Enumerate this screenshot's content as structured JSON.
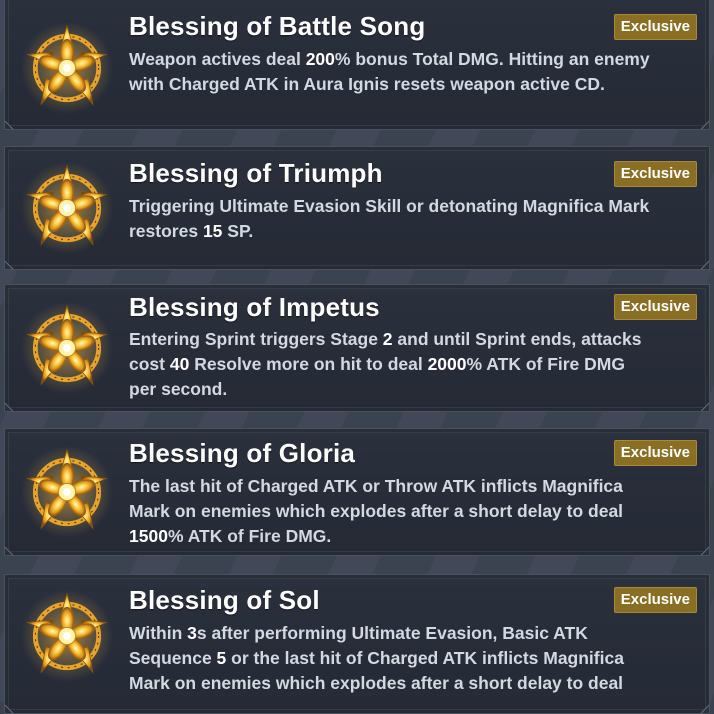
{
  "theme": {
    "badge_color": "#8a6e24",
    "card_color": "#262b36",
    "emblem_gold": "#f4c02c"
  },
  "blessings": [
    {
      "title": "Blessing of Battle Song",
      "badge": "Exclusive",
      "icon": "golden-flower-sigil-icon",
      "description": "Weapon actives deal 200% bonus Total DMG. Hitting an enemy with Charged ATK in Aura Ignis resets weapon active CD.",
      "lines": [
        "Weapon actives deal 200% bonus Total DMG. Hitting an enemy",
        "with Charged ATK in Aura Ignis resets weapon active CD."
      ]
    },
    {
      "title": "Blessing of Triumph",
      "badge": "Exclusive",
      "icon": "golden-flower-sigil-icon",
      "description": "Triggering Ultimate Evasion Skill or detonating Magnifica Mark restores 15 SP.",
      "lines": [
        "Triggering Ultimate Evasion Skill or detonating Magnifica Mark",
        "restores 15 SP."
      ]
    },
    {
      "title": "Blessing of Impetus",
      "badge": "Exclusive",
      "icon": "golden-flower-sigil-icon",
      "description": "Entering Sprint triggers Stage 2 and until Sprint ends, attacks cost 40 Resolve more on hit to deal 2000% ATK of Fire DMG per second.",
      "lines": [
        "Entering Sprint triggers Stage 2 and until Sprint ends, attacks",
        "cost 40 Resolve more on hit to deal 2000% ATK of Fire DMG",
        "per second."
      ]
    },
    {
      "title": "Blessing of Gloria",
      "badge": "Exclusive",
      "icon": "golden-flower-sigil-icon",
      "description": "The last hit of Charged ATK or Throw ATK inflicts Magnifica Mark on enemies which explodes after a short delay to deal 1500% ATK of Fire DMG.",
      "lines": [
        "The last hit of Charged ATK or Throw ATK inflicts Magnifica",
        "Mark on enemies which explodes after a short delay to deal",
        "1500% ATK of Fire DMG."
      ]
    },
    {
      "title": "Blessing of Sol",
      "badge": "Exclusive",
      "icon": "golden-flower-sigil-icon",
      "description": "Within 3s after performing Ultimate Evasion, Basic ATK Sequence 5 or the last hit of Charged ATK inflicts Magnifica Mark on enemies which explodes after a short delay to deal",
      "lines": [
        "Within 3s after performing Ultimate Evasion, Basic ATK",
        "Sequence 5 or the last hit of Charged ATK inflicts Magnifica",
        "Mark on enemies which explodes after a short delay to deal"
      ]
    }
  ]
}
